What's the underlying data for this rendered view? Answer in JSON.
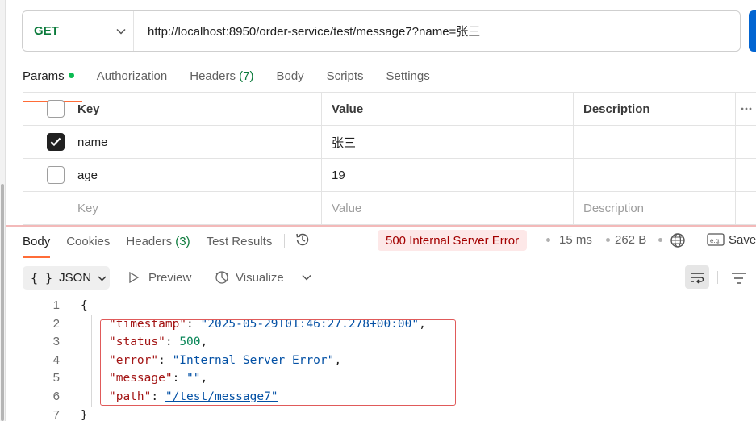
{
  "request": {
    "method": "GET",
    "url": "http://localhost:8950/order-service/test/message7?name=张三"
  },
  "request_tabs": [
    {
      "label": "Params",
      "count": "",
      "active": true
    },
    {
      "label": "Authorization",
      "count": ""
    },
    {
      "label": "Headers",
      "count": "(7)"
    },
    {
      "label": "Body",
      "count": ""
    },
    {
      "label": "Scripts",
      "count": ""
    },
    {
      "label": "Settings",
      "count": ""
    }
  ],
  "params": {
    "headers": {
      "key": "Key",
      "value": "Value",
      "description": "Description"
    },
    "rows": [
      {
        "checked": true,
        "key": "name",
        "value": "张三",
        "description": ""
      },
      {
        "checked": false,
        "key": "age",
        "value": "19",
        "description": ""
      }
    ],
    "placeholders": {
      "key": "Key",
      "value": "Value",
      "description": "Description"
    }
  },
  "response_tabs": [
    {
      "label": "Body",
      "count": "",
      "active": true
    },
    {
      "label": "Cookies",
      "count": ""
    },
    {
      "label": "Headers",
      "count": "(3)"
    },
    {
      "label": "Test Results",
      "count": ""
    }
  ],
  "response_meta": {
    "status": "500 Internal Server Error",
    "time": "15 ms",
    "size": "262 B",
    "save_label": "Save"
  },
  "body_toolbar": {
    "format": "JSON",
    "preview": "Preview",
    "visualize": "Visualize"
  },
  "code_lines": {
    "l1": {
      "num": "1",
      "text": "{"
    },
    "l2": {
      "num": "2",
      "key": "\"timestamp\"",
      "value": "\"2025-05-29T01:46:27.278+00:00\""
    },
    "l3": {
      "num": "3",
      "key": "\"status\"",
      "value": "500"
    },
    "l4": {
      "num": "4",
      "key": "\"error\"",
      "value": "\"Internal Server Error\""
    },
    "l5": {
      "num": "5",
      "key": "\"message\"",
      "value": "\"\""
    },
    "l6": {
      "num": "6",
      "key": "\"path\"",
      "value": "\"/test/message7\""
    },
    "l7": {
      "num": "7",
      "text": "}"
    }
  },
  "colors": {
    "method": "#0b7a3b",
    "active_tab_underline": "#ff6c37",
    "error_badge_bg": "#fde8e8",
    "error_badge_text": "#a30000",
    "highlight_border": "#e05a5a"
  }
}
